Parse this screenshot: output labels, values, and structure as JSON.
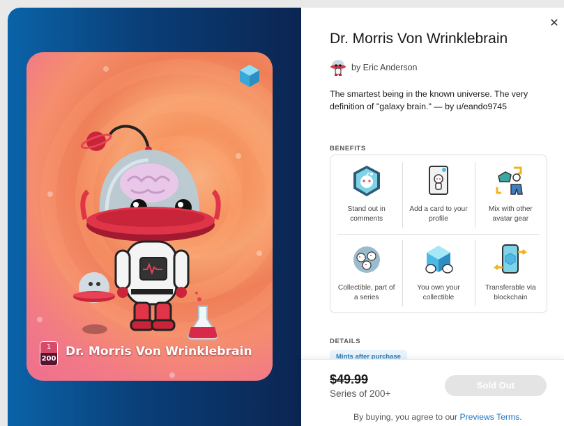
{
  "colors": {
    "accent_link": "#1a72c0",
    "sold_out_bg": "#e4e4e4",
    "left_panel_gradient": [
      "#0a63a8",
      "#0b2552"
    ]
  },
  "card": {
    "name": "Dr. Morris Von Wrinklebrain",
    "mint_number": "1",
    "mint_total": "200"
  },
  "product": {
    "title": "Dr. Morris Von Wrinklebrain",
    "creator": "by Eric Anderson",
    "description": "The smartest being in the known universe. The very definition of \"galaxy brain.\" — by u/eando9745"
  },
  "benefits": {
    "label": "BENEFITS",
    "items": [
      {
        "icon": "standout-comments-icon",
        "label": "Stand out in comments"
      },
      {
        "icon": "profile-card-icon",
        "label": "Add a card to your profile"
      },
      {
        "icon": "avatar-gear-icon",
        "label": "Mix with other avatar gear"
      },
      {
        "icon": "collectible-series-icon",
        "label": "Collectible, part of a series"
      },
      {
        "icon": "own-collectible-icon",
        "label": "You own your collectible"
      },
      {
        "icon": "blockchain-transfer-icon",
        "label": "Transferable via blockchain"
      }
    ]
  },
  "details": {
    "label": "DETAILS",
    "pill": "Mints after purchase"
  },
  "footer": {
    "price": "$49.99",
    "series": "Series of 200+",
    "button": "Sold Out",
    "terms_prefix": "By buying, you agree to our ",
    "terms_link": "Previews Terms",
    "terms_suffix": "."
  },
  "close_icon": "close-icon"
}
